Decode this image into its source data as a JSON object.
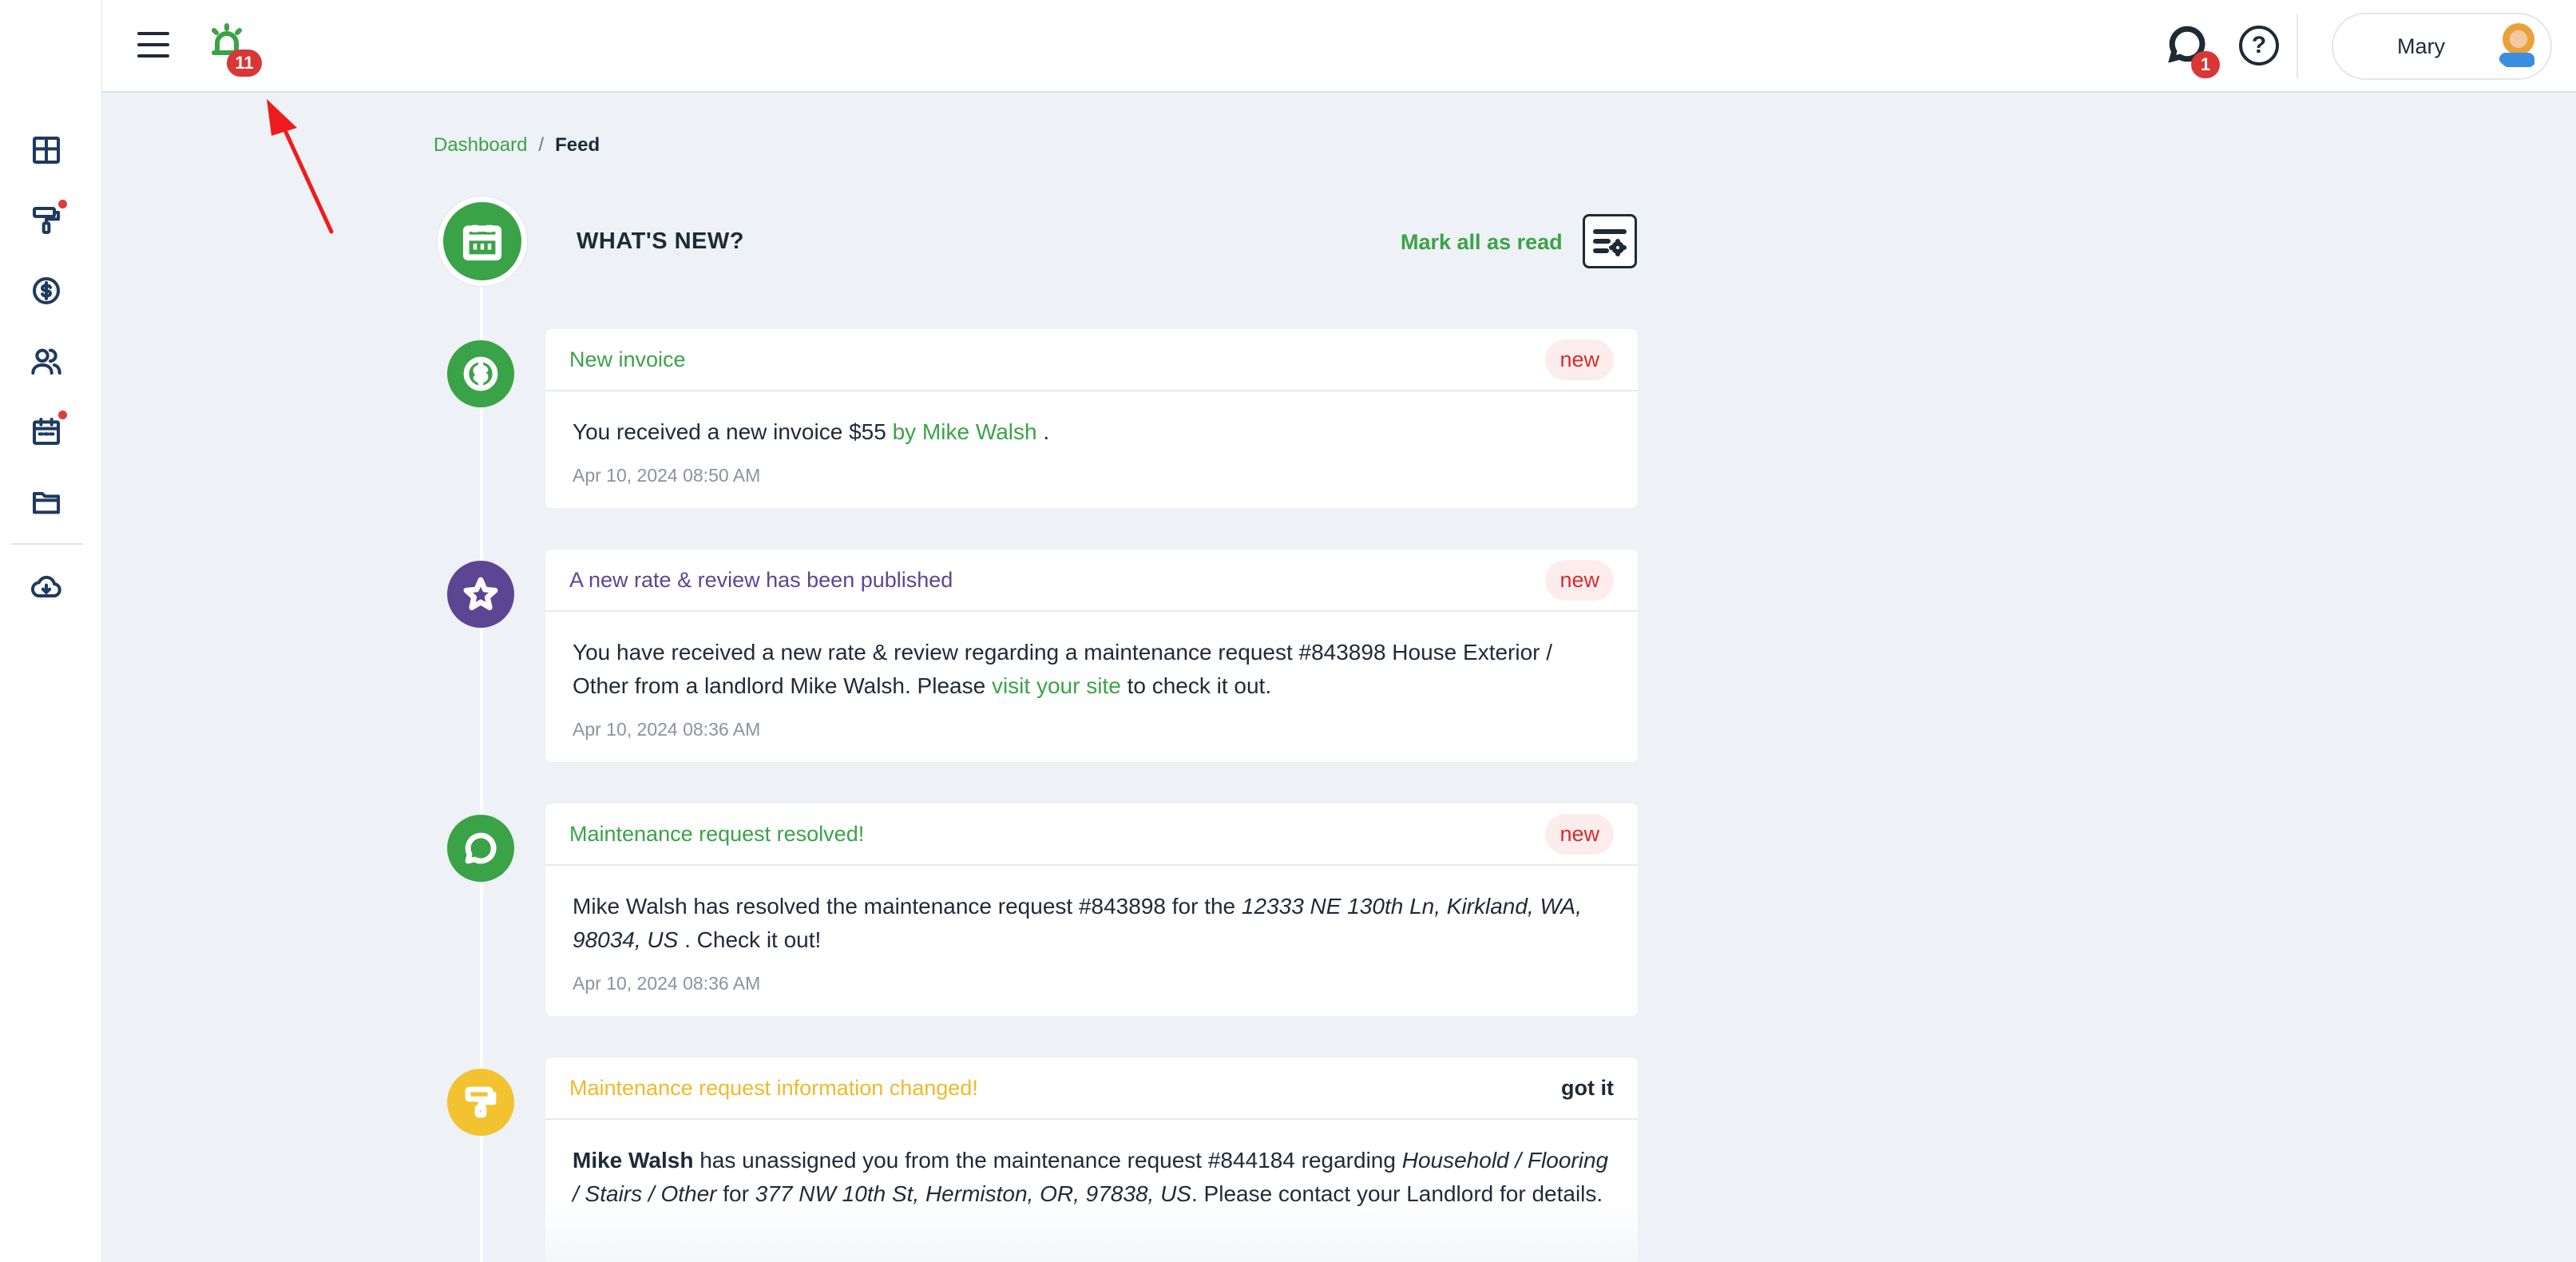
{
  "topbar": {
    "alarm_count": "11",
    "chat_count": "1",
    "help_label": "?",
    "user_name": "Mary"
  },
  "breadcrumb": {
    "home": "Dashboard",
    "separator": "/",
    "current": "Feed"
  },
  "feed": {
    "title": "WHAT'S NEW?",
    "mark_all_label": "Mark all as read",
    "items": [
      {
        "title": "New invoice",
        "status": "new",
        "icon": "dollar-icon",
        "body_prefix": "You received a new invoice $55",
        "body_link": "by Mike Walsh",
        "body_suffix": ".",
        "date": "Apr 10, 2024 08:50 AM"
      },
      {
        "title": "A new rate & review has been published",
        "status": "new",
        "icon": "star-icon",
        "body_prefix": "You have received a new rate & review regarding a maintenance request #843898 House Exterior / Other from a landlord Mike Walsh. Please",
        "body_link": "visit your site",
        "body_suffix": "to check it out.",
        "date": "Apr 10, 2024 08:36 AM"
      },
      {
        "title": "Maintenance request resolved!",
        "status": "new",
        "icon": "chat-bubble-icon",
        "body_prefix": "Mike Walsh has resolved the maintenance request #843898 for the",
        "body_italic": "12333 NE 130th Ln, Kirkland, WA, 98034, US",
        "body_suffix": ". Check it out!",
        "date": "Apr 10, 2024 08:36 AM"
      },
      {
        "title": "Maintenance request information changed!",
        "status": "got it",
        "icon": "paint-roller-icon",
        "body_bold": "Mike Walsh",
        "body_part1": "has unassigned you from the maintenance request #844184 regarding",
        "body_italic1": "Household / Flooring / Stairs / Other",
        "body_part2": "for",
        "body_italic2": "377 NW 10th St, Hermiston, OR, 97838, US",
        "body_part3": ". Please contact your Landlord for details."
      }
    ]
  },
  "colors": {
    "accent_green": "#3aa347",
    "purple": "#5e4593",
    "yellow": "#f2c230",
    "badge_red": "#d93636"
  }
}
